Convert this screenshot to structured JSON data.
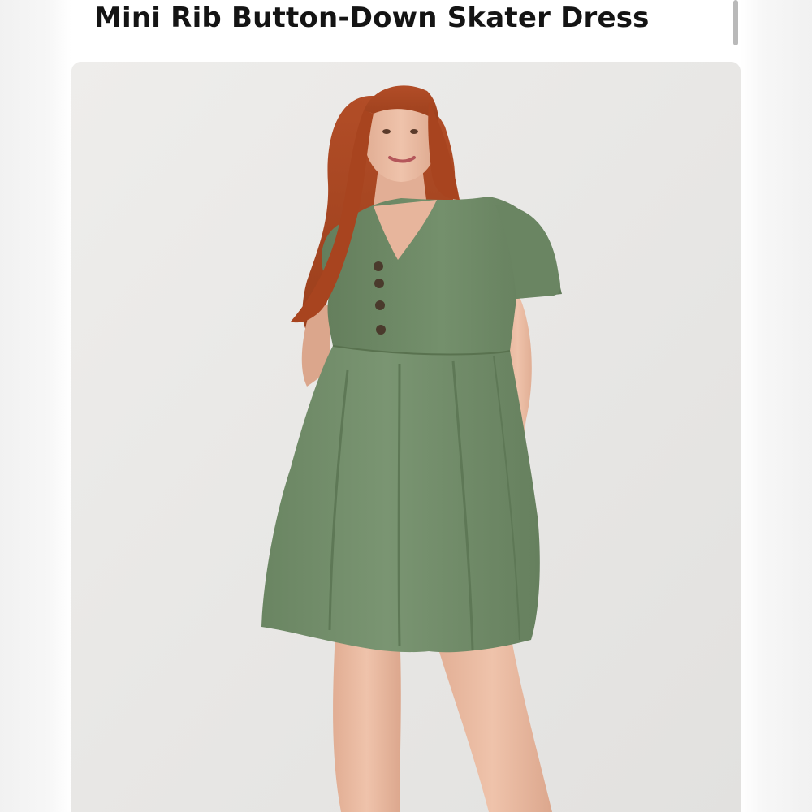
{
  "product": {
    "title": "Mini Rib Button-Down Skater Dress"
  },
  "photo": {
    "alt": "Model wearing sage green ribbed button-down skater dress with short sleeves",
    "dress_color": "#6f8a67",
    "hair_color": "#b04a24",
    "skin_color": "#e9b9a1",
    "button_color": "#4a3a2c",
    "background_color": "#e8e7e5"
  },
  "colors": {
    "title_text": "#141414",
    "scrollbar": "#b9b9b9"
  }
}
